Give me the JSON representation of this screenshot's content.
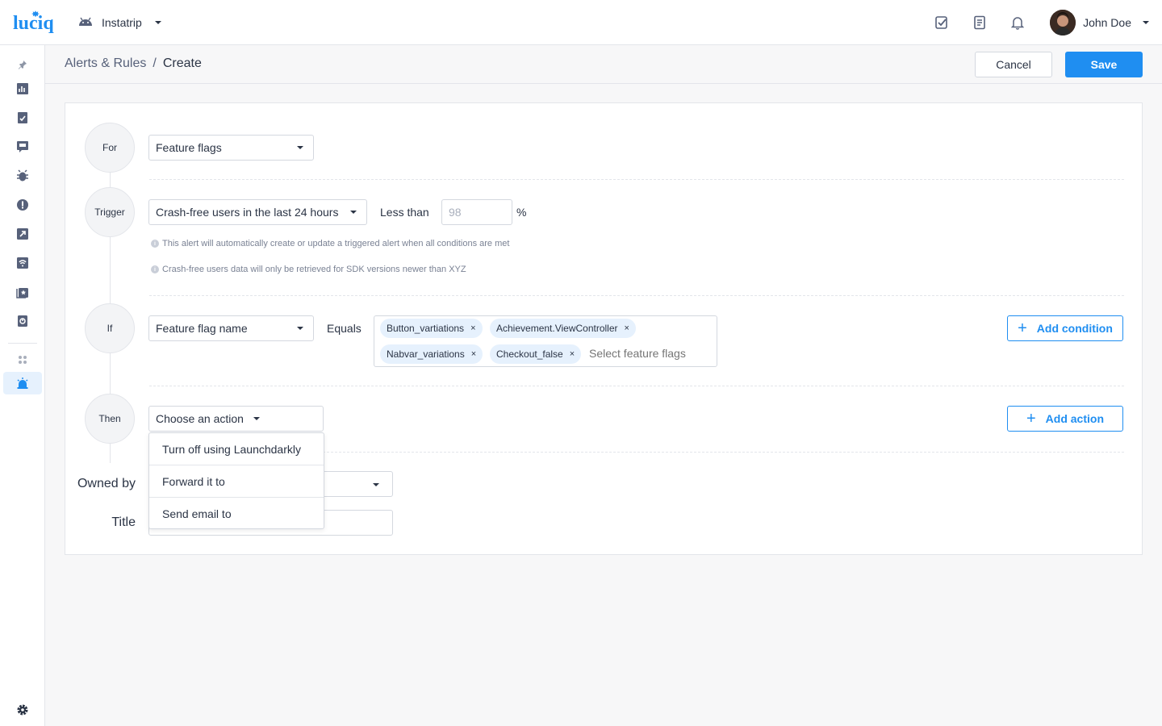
{
  "brand": {
    "logo_text": "luciq",
    "color": "#1f8ef1"
  },
  "app_switcher": {
    "platform_icon": "android-icon",
    "app_name": "Instatrip"
  },
  "top_icons": [
    "checklist-icon",
    "document-icon",
    "bell-icon"
  ],
  "user": {
    "name": "John Doe"
  },
  "sidebar": {
    "items": [
      "pin-icon",
      "dashboard-icon",
      "apm-icon",
      "feedback-icon",
      "bug-icon",
      "crash-icon",
      "release-icon",
      "network-icon",
      "rating-icon",
      "sessions-icon",
      "apps-icon",
      "alerts-icon"
    ],
    "active": "alerts-icon",
    "bottom": "settings-icon"
  },
  "header": {
    "breadcrumb_parent": "Alerts & Rules",
    "breadcrumb_sep": "/",
    "breadcrumb_current": "Create",
    "cancel_label": "Cancel",
    "save_label": "Save"
  },
  "steps": {
    "for": {
      "label": "For",
      "select_value": "Feature flags"
    },
    "trigger": {
      "label": "Trigger",
      "metric_value": "Crash-free users in the last 24 hours",
      "operator_label": "Less than",
      "threshold_placeholder": "98",
      "unit": "%",
      "note_1": "This alert will automatically create or update a triggered alert when all conditions are met",
      "note_2": "Crash-free users data will only be retrieved for SDK versions newer than XYZ"
    },
    "if": {
      "label": "If",
      "field_value": "Feature flag name",
      "operator_label": "Equals",
      "tags": [
        "Button_vartiations",
        "Achievement.ViewController",
        "Nabvar_variations",
        "Checkout_false"
      ],
      "tag_remove": "×",
      "tags_placeholder": "Select feature flags",
      "add_label": "Add condition"
    },
    "then": {
      "label": "Then",
      "action_value": "Choose an action",
      "add_label": "Add action",
      "dropdown_options": [
        "Turn off using Launchdarkly",
        "Forward it to",
        "Send email to"
      ]
    }
  },
  "owned_by": {
    "label": "Owned by"
  },
  "title_field": {
    "label": "Title"
  }
}
